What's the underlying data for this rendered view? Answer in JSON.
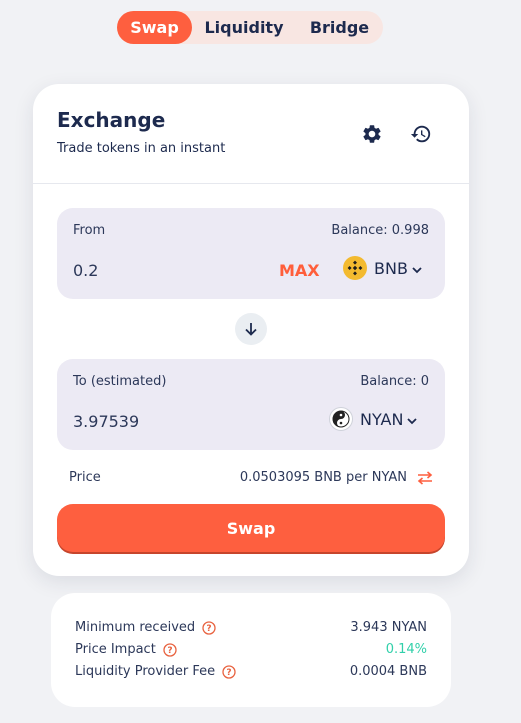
{
  "tabs": [
    {
      "label": "Swap",
      "active": true
    },
    {
      "label": "Liquidity",
      "active": false
    },
    {
      "label": "Bridge",
      "active": false
    }
  ],
  "card": {
    "title": "Exchange",
    "subtitle": "Trade tokens in an instant",
    "icons": [
      "gear-icon",
      "history-icon"
    ]
  },
  "from": {
    "label": "From",
    "balance": "Balance: 0.998",
    "amount": "0.2",
    "max_label": "MAX",
    "token": "BNB"
  },
  "to": {
    "label": "To (estimated)",
    "balance": "Balance: 0",
    "amount": "3.97539",
    "token": "NYAN"
  },
  "price": {
    "label": "Price",
    "value": "0.0503095 BNB per NYAN"
  },
  "swap_button": "Swap",
  "details": {
    "minimum_received": {
      "label": "Minimum received",
      "value": "3.943 NYAN"
    },
    "price_impact": {
      "label": "Price Impact",
      "value": "0.14%"
    },
    "lp_fee": {
      "label": "Liquidity Provider Fee",
      "value": "0.0004 BNB"
    }
  },
  "colors": {
    "accent": "#fe5f3f",
    "text": "#1d2a4e",
    "input_bg": "#eceaf4",
    "positive": "#31d0aa"
  }
}
